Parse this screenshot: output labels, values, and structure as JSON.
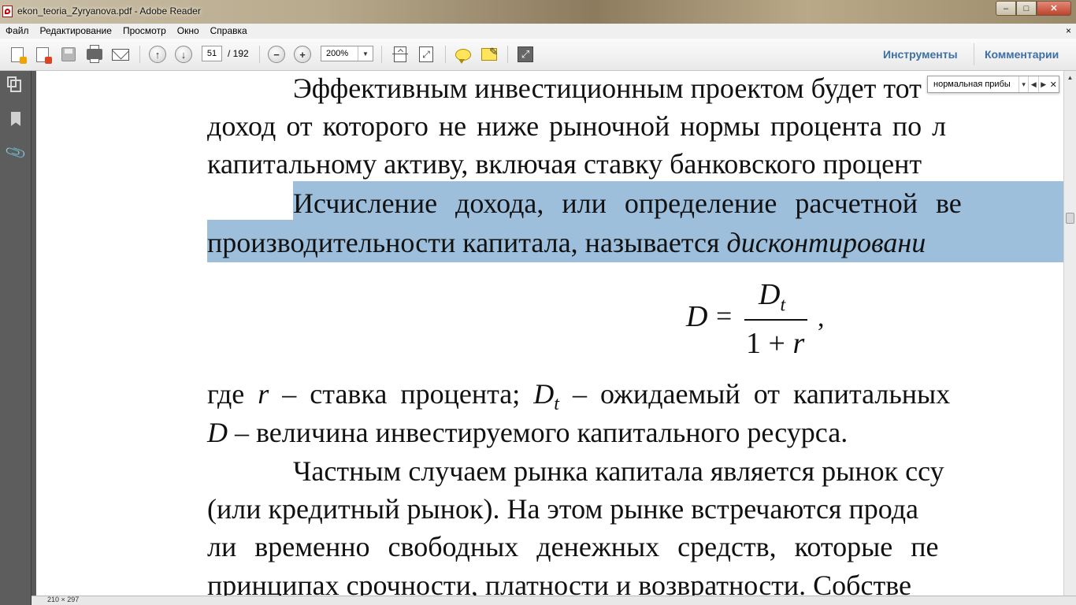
{
  "window": {
    "title": "ekon_teoria_Zyryanova.pdf - Adobe Reader"
  },
  "menu": [
    "Файл",
    "Редактирование",
    "Просмотр",
    "Окно",
    "Справка"
  ],
  "menu_close": "×",
  "toolbar": {
    "page_current": "51",
    "page_total": "/ 192",
    "zoom": "200%",
    "tools_label": "Инструменты",
    "comments_label": "Комментарии"
  },
  "search": {
    "query": "нормальная прибы"
  },
  "document": {
    "lines": [
      "Эффективным инвестиционным проектом будет тот",
      "доход от которого не ниже рыночной нормы процента по л",
      "капитальному активу, включая ставку банковского процент",
      "Исчисление дохода, или определение расчетной ве",
      "производительности капитала, называется",
      "дисконтировани",
      "где",
      "r",
      "– ставка процента;",
      "D",
      "t",
      "– ожидаемый от капитальных",
      "D",
      "– величина инвестируемого капитального ресурса.",
      "Частным случаем рынка капитала является рынок ссу",
      "(или кредитный рынок). На этом рынке встречаются прода",
      "ли временно свободных денежных средств, которые пе",
      "принципах срочности, платности и возвратности. Собстве"
    ],
    "formula": {
      "lhs": "D",
      "eq": "=",
      "num": "D",
      "num_sub": "t",
      "den_a": "1 +",
      "den_b": "r",
      "trail": ","
    }
  },
  "status": {
    "size": "210 × 297"
  },
  "colors": {
    "highlight": "#9dbfdc",
    "link": "#3d6fa5"
  }
}
